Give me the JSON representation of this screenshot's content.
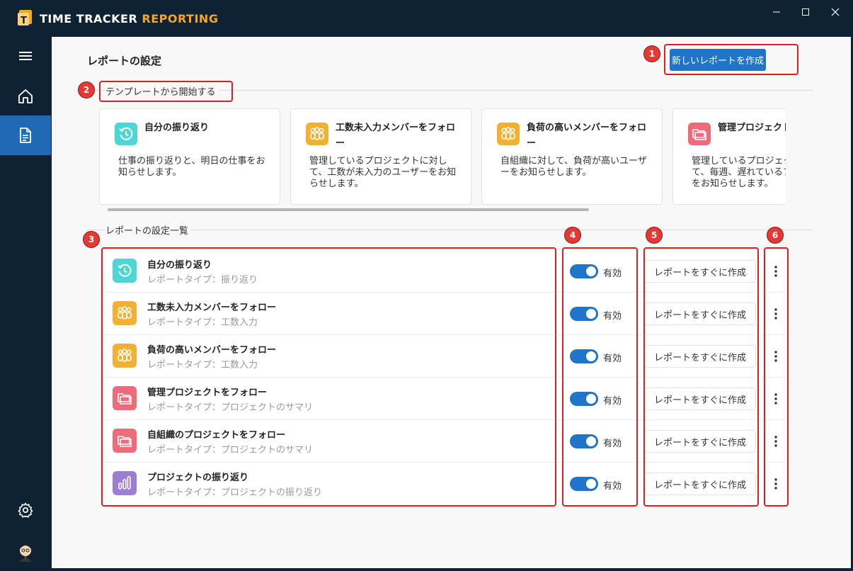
{
  "app": {
    "title_main": "TIME TRACKER",
    "title_accent": "REPORTING",
    "colors": {
      "brand_navy": "#0e2233",
      "accent_blue": "#1f75c9",
      "accent_orange": "#f5a623",
      "callout_red": "#e53935"
    }
  },
  "window": {
    "minimize": "—",
    "maximize": "☐",
    "close": "✕"
  },
  "sidebar": {
    "items": [
      {
        "name": "menu",
        "icon": "hamburger-icon"
      },
      {
        "name": "home",
        "icon": "home-icon"
      },
      {
        "name": "reports",
        "icon": "document-icon",
        "active": true
      },
      {
        "name": "settings",
        "icon": "gear-icon"
      },
      {
        "name": "user",
        "icon": "avatar-icon"
      }
    ]
  },
  "header": {
    "title": "レポートの設定",
    "new_report_label": "新しいレポートを作成"
  },
  "templates": {
    "section_label": "テンプレートから開始する",
    "cards": [
      {
        "title": "自分の振り返り",
        "desc": "仕事の振り返りと、明日の仕事をお知らせします。",
        "icon": "history-clock-icon",
        "color": "#4dd6d6"
      },
      {
        "title": "工数未入力メンバーをフォロー",
        "desc": "管理しているプロジェクトに対して、工数が未入力のユーザーをお知らせします。",
        "icon": "people-group-icon",
        "color": "#f2b134"
      },
      {
        "title": "負荷の高いメンバーをフォロー",
        "desc": "自組織に対して、負荷が高いユーザーをお知らせします。",
        "icon": "people-group-icon",
        "color": "#f2b134"
      },
      {
        "title": "管理プロジェクトをフォロー",
        "desc": "管理しているプロジェクトに対して、毎週、遅れているプロジェクトをお知らせします。",
        "icon": "folders-icon",
        "color": "#f06b7a"
      }
    ]
  },
  "reports": {
    "section_label": "レポートの設定一覧",
    "toggle_label": "有効",
    "run_label": "レポートをすぐに作成",
    "rows": [
      {
        "title": "自分の振り返り",
        "type": "レポートタイプ：振り返り",
        "icon": "history-clock-icon",
        "color": "#4dd6d6",
        "enabled": true
      },
      {
        "title": "工数未入力メンバーをフォロー",
        "type": "レポートタイプ：工数入力",
        "icon": "people-group-icon",
        "color": "#f2b134",
        "enabled": true
      },
      {
        "title": "負荷の高いメンバーをフォロー",
        "type": "レポートタイプ：工数入力",
        "icon": "people-group-icon",
        "color": "#f2b134",
        "enabled": true
      },
      {
        "title": "管理プロジェクトをフォロー",
        "type": "レポートタイプ：プロジェクトのサマリ",
        "icon": "folders-icon",
        "color": "#f06b7a",
        "enabled": true
      },
      {
        "title": "自組織のプロジェクトをフォロー",
        "type": "レポートタイプ：プロジェクトのサマリ",
        "icon": "folders-icon",
        "color": "#f06b7a",
        "enabled": true
      },
      {
        "title": "プロジェクトの振り返り",
        "type": "レポートタイプ：プロジェクトの振り返り",
        "icon": "bar-chart-icon",
        "color": "#9b7fd4",
        "enabled": true
      }
    ]
  },
  "callouts": [
    "1",
    "2",
    "3",
    "4",
    "5",
    "6"
  ]
}
